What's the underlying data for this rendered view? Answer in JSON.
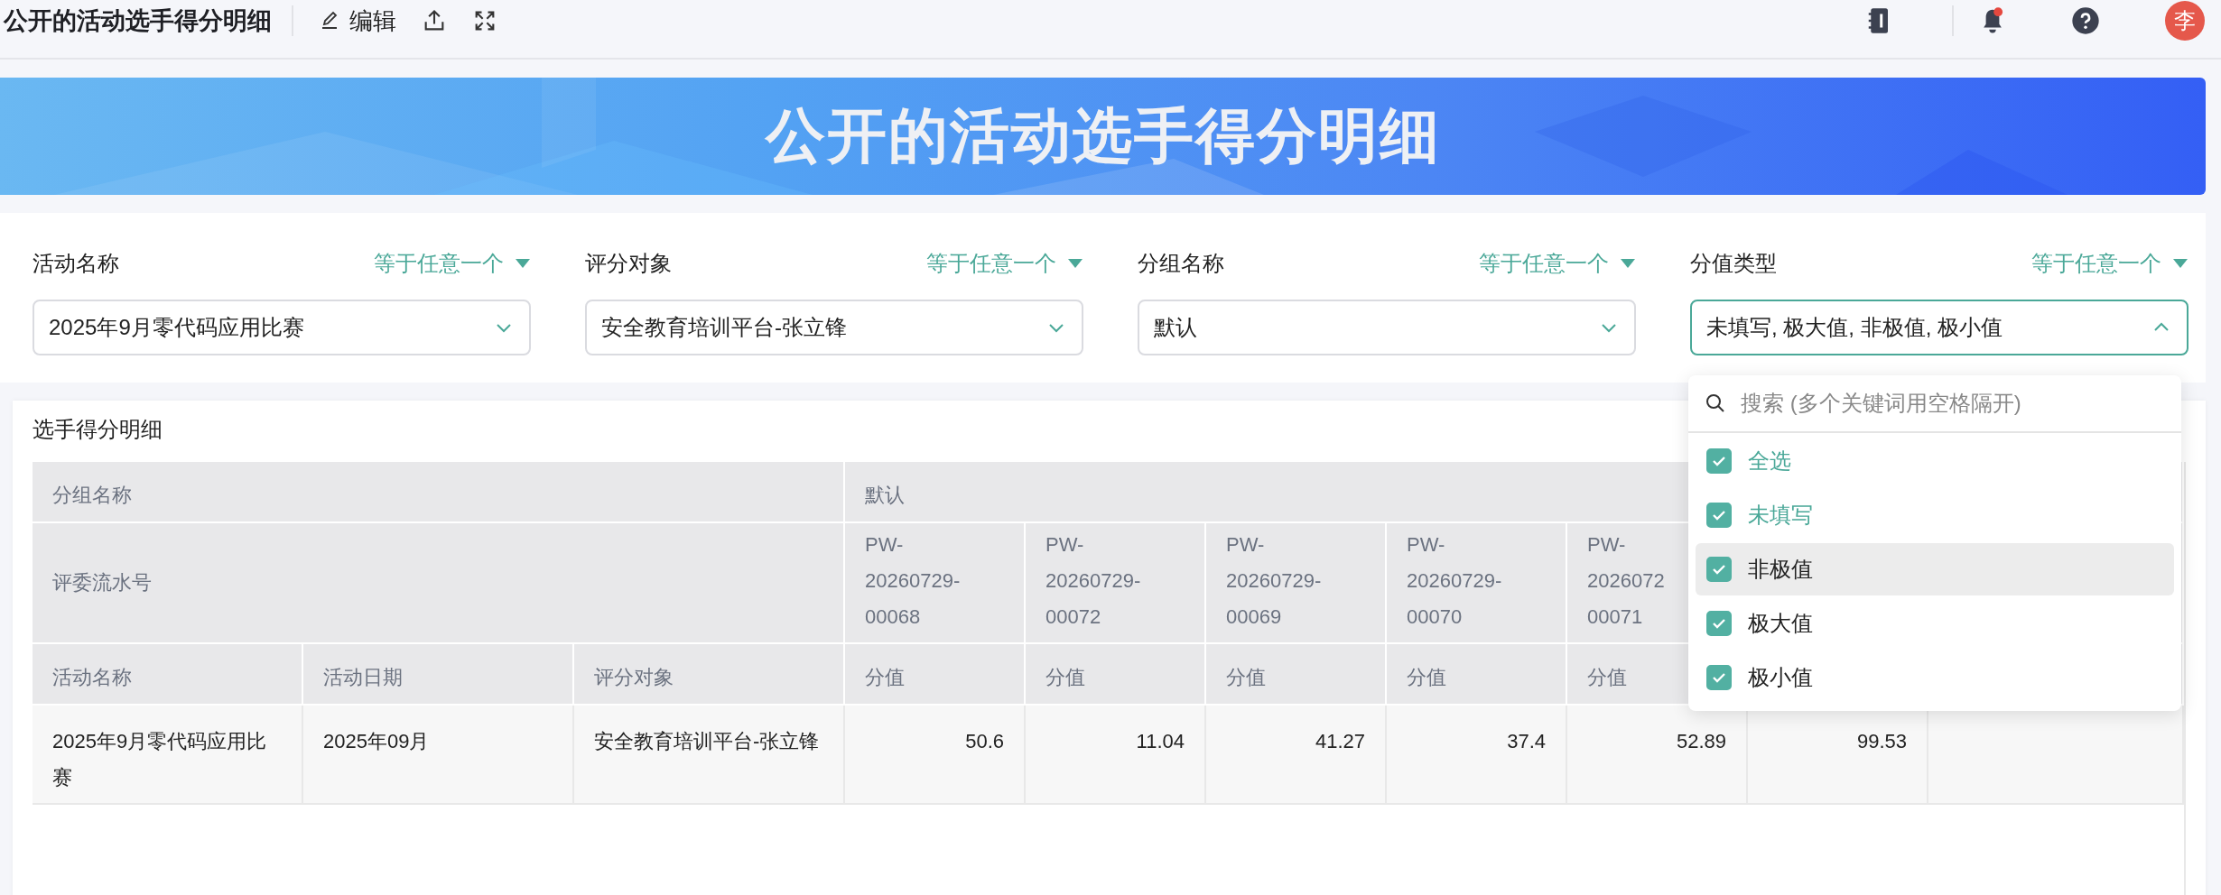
{
  "topbar": {
    "title": "公开的活动选手得分明细",
    "edit_label": "编辑",
    "notification_dot": true,
    "avatar": "李"
  },
  "banner": {
    "title": "公开的活动选手得分明细"
  },
  "filters": [
    {
      "label": "活动名称",
      "operator": "等于任意一个",
      "value": "2025年9月零代码应用比赛",
      "open": false
    },
    {
      "label": "评分对象",
      "operator": "等于任意一个",
      "value": "安全教育培训平台-张立锋",
      "open": false
    },
    {
      "label": "分组名称",
      "operator": "等于任意一个",
      "value": "默认",
      "open": false
    },
    {
      "label": "分值类型",
      "operator": "等于任意一个",
      "value": "未填写, 极大值, 非极值, 极小值",
      "open": true
    }
  ],
  "dropdown": {
    "placeholder": "搜索 (多个关键词用空格隔开)",
    "options": [
      {
        "label": "全选",
        "checked": true,
        "highlighted": true,
        "hovered": false
      },
      {
        "label": "未填写",
        "checked": true,
        "highlighted": true,
        "hovered": false
      },
      {
        "label": "非极值",
        "checked": true,
        "highlighted": false,
        "hovered": true
      },
      {
        "label": "极大值",
        "checked": true,
        "highlighted": false,
        "hovered": false
      },
      {
        "label": "极小值",
        "checked": true,
        "highlighted": false,
        "hovered": false
      }
    ]
  },
  "table": {
    "title": "选手得分明细",
    "group_header": "分组名称",
    "group_value": "默认",
    "judge_header": "评委流水号",
    "columns": [
      "活动名称",
      "活动日期",
      "评分对象"
    ],
    "score_columns": [
      {
        "judge": "PW-20260729-00068",
        "label": "分值"
      },
      {
        "judge": "PW-20260729-00072",
        "label": "分值"
      },
      {
        "judge": "PW-20260729-00069",
        "label": "分值"
      },
      {
        "judge": "PW-20260729-00070",
        "label": "分值"
      },
      {
        "judge": "PW-2026072 00071",
        "label": "分值"
      },
      {}
    ],
    "rows": [
      {
        "cells": [
          "2025年9月零代码应用比赛",
          "2025年09月",
          "安全教育培训平台-张立锋"
        ],
        "scores": [
          "50.6",
          "11.04",
          "41.27",
          "37.4",
          "52.89",
          "99.53"
        ]
      }
    ]
  }
}
